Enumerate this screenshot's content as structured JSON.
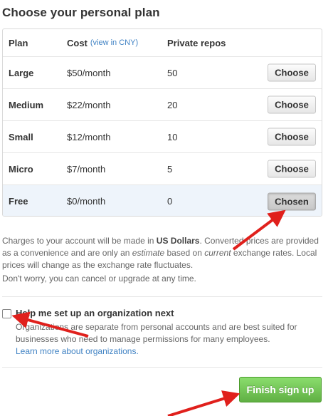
{
  "page": {
    "title": "Choose your personal plan"
  },
  "table": {
    "headers": {
      "plan": "Plan",
      "cost": "Cost",
      "cny_link": "(view in CNY)",
      "repos": "Private repos"
    },
    "rows": [
      {
        "plan": "Large",
        "cost": "$50/month",
        "repos": "50",
        "button": "Choose"
      },
      {
        "plan": "Medium",
        "cost": "$22/month",
        "repos": "20",
        "button": "Choose"
      },
      {
        "plan": "Small",
        "cost": "$12/month",
        "repos": "10",
        "button": "Choose"
      },
      {
        "plan": "Micro",
        "cost": "$7/month",
        "repos": "5",
        "button": "Choose"
      },
      {
        "plan": "Free",
        "cost": "$0/month",
        "repos": "0",
        "button": "Chosen"
      }
    ]
  },
  "notice": {
    "p1_a": "Charges to your account will be made in ",
    "p1_b": "US Dollars",
    "p1_c": ". Converted prices are provided as a convenience and are only an ",
    "p1_d": "estimate",
    "p1_e": " based on ",
    "p1_f": "current",
    "p1_g": " exchange rates. Local prices will change as the exchange rate fluctuates.",
    "p2": "Don't worry, you can cancel or upgrade at any time."
  },
  "organization": {
    "label": "Help me set up an organization next",
    "checked": false,
    "description": "Organizations are separate from personal accounts and are best suited for businesses who need to manage permissions for many employees.",
    "link": "Learn more about organizations."
  },
  "finish": {
    "label": "Finish sign up"
  },
  "colors": {
    "link": "#4183c4",
    "finish_green": "#60b044",
    "arrow_red": "#e0201c",
    "current_row": "#eef4fb"
  }
}
